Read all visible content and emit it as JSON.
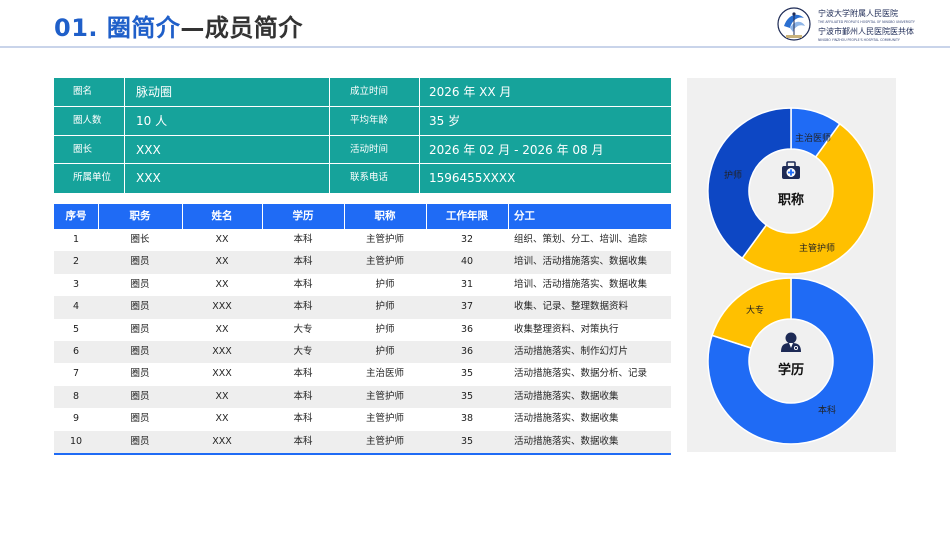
{
  "title": {
    "number": "01.",
    "main": "圈简介",
    "sub": "—成员简介"
  },
  "logo": {
    "line1": "宁波大学附属人民医院",
    "line1_en": "THE AFFILIATED PEOPLE'S HOSPITAL OF NINGBO UNIVERSITY",
    "line2": "宁波市鄞州人民医院医共体",
    "line2_en": "NINGBO YINZHOU PEOPLE'S HOSPITAL COMMUNITY"
  },
  "info": [
    {
      "label1": "圈名",
      "value1": "脉动圈",
      "label2": "成立时间",
      "value2": "2026 年 XX 月"
    },
    {
      "label1": "圈人数",
      "value1": "10 人",
      "label2": "平均年龄",
      "value2": "35 岁"
    },
    {
      "label1": "圈长",
      "value1": "XXX",
      "label2": "活动时间",
      "value2": "2026 年 02 月 - 2026 年 08 月"
    },
    {
      "label1": "所属单位",
      "value1": "XXX",
      "label2": "联系电话",
      "value2": "1596455XXXX"
    }
  ],
  "members": {
    "headers": [
      "序号",
      "职务",
      "姓名",
      "学历",
      "职称",
      "工作年限",
      "分工"
    ],
    "rows": [
      [
        "1",
        "圈长",
        "XX",
        "本科",
        "主管护师",
        "32",
        "组织、策划、分工、培训、追踪"
      ],
      [
        "2",
        "圈员",
        "XX",
        "本科",
        "主管护师",
        "40",
        "培训、活动措施落实、数据收集"
      ],
      [
        "3",
        "圈员",
        "XX",
        "本科",
        "护师",
        "31",
        "培训、活动措施落实、数据收集"
      ],
      [
        "4",
        "圈员",
        "XXX",
        "本科",
        "护师",
        "37",
        "收集、记录、整理数据资料"
      ],
      [
        "5",
        "圈员",
        "XX",
        "大专",
        "护师",
        "36",
        "收集整理资料、对策执行"
      ],
      [
        "6",
        "圈员",
        "XXX",
        "大专",
        "护师",
        "36",
        "活动措施落实、制作幻灯片"
      ],
      [
        "7",
        "圈员",
        "XXX",
        "本科",
        "主治医师",
        "35",
        "活动措施落实、数据分析、记录"
      ],
      [
        "8",
        "圈员",
        "XX",
        "本科",
        "主管护师",
        "35",
        "活动措施落实、数据收集"
      ],
      [
        "9",
        "圈员",
        "XX",
        "本科",
        "主管护师",
        "38",
        "活动措施落实、数据收集"
      ],
      [
        "10",
        "圈员",
        "XXX",
        "本科",
        "主管护师",
        "35",
        "活动措施落实、数据收集"
      ]
    ]
  },
  "chart_data": [
    {
      "type": "pie",
      "title": "职称",
      "icon": "medical-kit-icon",
      "categories": [
        "主治医师",
        "主管护师",
        "护师"
      ],
      "values": [
        1,
        5,
        4
      ],
      "colors": [
        "#1f6bf5",
        "#ffc000",
        "#0d47c4"
      ]
    },
    {
      "type": "pie",
      "title": "学历",
      "icon": "doctor-icon",
      "categories": [
        "本科",
        "大专"
      ],
      "values": [
        8,
        2
      ],
      "colors": [
        "#1f6bf5",
        "#ffc000"
      ]
    }
  ],
  "colors": {
    "accent": "#1f5fc9",
    "teal": "#16a39b",
    "header_blue": "#1f6bf5",
    "yellow": "#ffc000",
    "dark_blue": "#0d47c4"
  }
}
